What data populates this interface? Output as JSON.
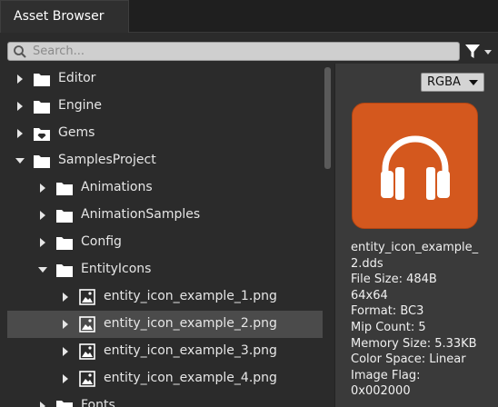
{
  "window": {
    "tab_title": "Asset Browser"
  },
  "search": {
    "placeholder": "Search...",
    "value": ""
  },
  "tree": {
    "items": [
      {
        "label": "Editor",
        "expanded": false,
        "icon": "folder-icon"
      },
      {
        "label": "Engine",
        "expanded": false,
        "icon": "folder-icon"
      },
      {
        "label": "Gems",
        "expanded": false,
        "icon": "gem-folder-icon"
      },
      {
        "label": "SamplesProject",
        "expanded": true,
        "icon": "folder-icon"
      },
      {
        "label": "Animations",
        "expanded": false,
        "icon": "folder-icon"
      },
      {
        "label": "AnimationSamples",
        "expanded": false,
        "icon": "folder-icon"
      },
      {
        "label": "Config",
        "expanded": false,
        "icon": "folder-icon"
      },
      {
        "label": "EntityIcons",
        "expanded": true,
        "icon": "folder-icon"
      },
      {
        "label": "entity_icon_example_1.png",
        "icon": "image-file-icon"
      },
      {
        "label": "entity_icon_example_2.png",
        "icon": "image-file-icon",
        "selected": true
      },
      {
        "label": "entity_icon_example_3.png",
        "icon": "image-file-icon"
      },
      {
        "label": "entity_icon_example_4.png",
        "icon": "image-file-icon"
      },
      {
        "label": "Fonts",
        "expanded": false,
        "icon": "folder-icon"
      }
    ]
  },
  "preview": {
    "channel_select": "RGBA",
    "thumbnail_icon": "headphones-icon",
    "thumbnail_color": "#d4581e",
    "info_lines": [
      "entity_icon_example_",
      "2.dds",
      "File Size: 484B",
      "64x64",
      "Format: BC3",
      "Mip Count: 5",
      "Memory Size: 5.33KB",
      "Color Space: Linear",
      "Image Flag:",
      "0x002000"
    ]
  }
}
